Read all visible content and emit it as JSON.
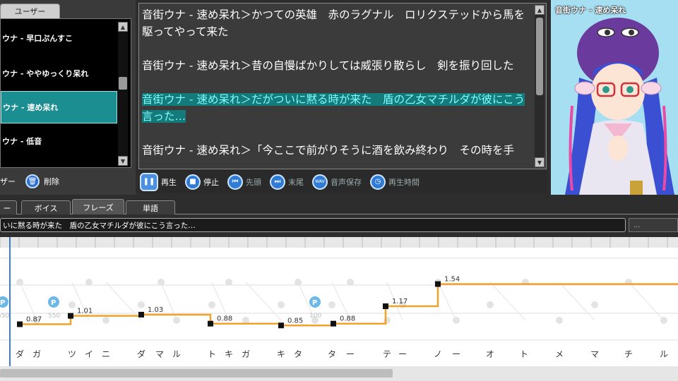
{
  "voice_list": {
    "tab_label": "ユーザー",
    "items": [
      {
        "label": "ウナ - 早口ぷんすこ",
        "selected": false
      },
      {
        "label": "ウナ - ややゆっくり呆れ",
        "selected": false
      },
      {
        "label": "ウナ - 速め呆れ",
        "selected": true
      },
      {
        "label": "ウナ - 低音",
        "selected": false
      }
    ],
    "user_label": "ザー",
    "delete_label": "削除"
  },
  "text_area": {
    "paragraphs": [
      {
        "text": "音街ウナ - 速め呆れ＞かつての英雄　赤のラグナル　ロリクステッドから馬を駆ってやって来た",
        "highlighted": false
      },
      {
        "text": "音街ウナ - 速め呆れ＞昔の自慢ばかりしては威張り散らし　剣を振り回した",
        "highlighted": false
      },
      {
        "text": "音街ウナ - 速め呆れ＞だがついに黙る時が来た　盾の乙女マチルダが彼にこう言った…",
        "highlighted": true
      },
      {
        "text": "音街ウナ - 速め呆れ＞「今ここで前がりそうに酒を飲み終わり　その時を手",
        "highlighted": false
      }
    ]
  },
  "toolbar": {
    "play": "再生",
    "stop": "停止",
    "head": "先頭",
    "end": "末尾",
    "save_audio": "音声保存",
    "play_time": "再生時間",
    "wav_icon_text": "WAV"
  },
  "character": {
    "title": "音街ウナ - 速め呆れ"
  },
  "tabs": [
    {
      "label": "ー",
      "active": false
    },
    {
      "label": "ボイス",
      "active": false
    },
    {
      "label": "フレーズ",
      "active": true
    },
    {
      "label": "単語",
      "active": false
    }
  ],
  "phrase": {
    "text": "いに黙る時が来た　盾の乙女マチルダが彼にこう言った…",
    "side": "..."
  },
  "chart_data": {
    "type": "line",
    "kana": [
      "ダ",
      "ガ",
      "ツ",
      "イ",
      "ニ",
      "ダ",
      "マ",
      "ル",
      "ト",
      "キ",
      "ガ",
      "キ",
      "タ",
      "タ",
      "ー",
      "テ",
      "ー",
      "ノ",
      "ー",
      "オ",
      "ト",
      "メ",
      "マ",
      "チ",
      "ル"
    ],
    "segments": [
      {
        "value": 0.87
      },
      {
        "value": 1.01
      },
      {
        "value": 1.03
      },
      {
        "value": 0.88
      },
      {
        "value": 0.85
      },
      {
        "value": 0.88
      },
      {
        "value": 1.17
      },
      {
        "value": 1.54
      }
    ],
    "pause_markers": [
      "P",
      "P",
      "P"
    ],
    "pause_values": [
      "550",
      "550",
      "100"
    ],
    "colors": {
      "line": "#f0a22a",
      "node": "#111111",
      "cursor": "#3a7bd5"
    }
  }
}
